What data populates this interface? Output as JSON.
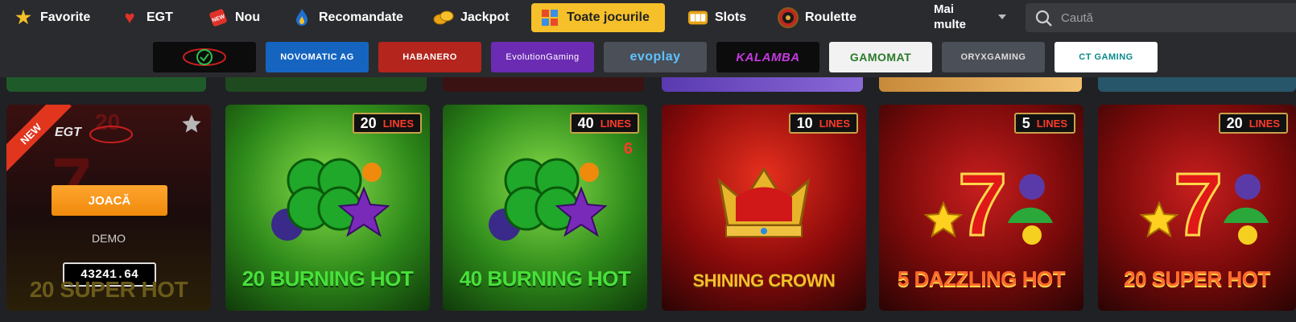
{
  "nav": {
    "items": [
      {
        "label": "Favorite",
        "icon": "star-icon"
      },
      {
        "label": "EGT",
        "icon": "heart-icon"
      },
      {
        "label": "Nou",
        "icon": "new-icon"
      },
      {
        "label": "Recomandate",
        "icon": "flame-icon"
      },
      {
        "label": "Jackpot",
        "icon": "coins-icon"
      },
      {
        "label": "Toate jocurile",
        "icon": "grid-icon"
      },
      {
        "label": "Slots",
        "icon": "slot-machine-icon"
      },
      {
        "label": "Roulette",
        "icon": "roulette-icon"
      }
    ],
    "more_label_1": "Mai",
    "more_label_2": "multe",
    "search_placeholder": "Caută"
  },
  "providers": [
    {
      "label": "EGT"
    },
    {
      "label": "NOVOMATIC AG"
    },
    {
      "label": "HABANERO"
    },
    {
      "label": "EvolutionGaming"
    },
    {
      "label": "evoplay"
    },
    {
      "label": "KALAMBA"
    },
    {
      "label": "GAMOMAT"
    },
    {
      "label": "ORYXGAMING"
    },
    {
      "label": "CT GAMING"
    }
  ],
  "games": [
    {
      "title": "20 SUPER HOT",
      "badge_new": "NEW",
      "brand": "EGT",
      "play": "JOACĂ",
      "demo": "DEMO",
      "jackpot": "43241.64"
    },
    {
      "title": "20 BURNING HOT",
      "lines": "20",
      "lines_label": "LINES"
    },
    {
      "title": "40 BURNING HOT",
      "lines": "40",
      "lines_label": "LINES"
    },
    {
      "title": "SHINING CROWN",
      "lines": "10",
      "lines_label": "LINES"
    },
    {
      "title": "5 DAZZLING HOT",
      "lines": "5",
      "lines_label": "LINES"
    },
    {
      "title": "20 SUPER HOT",
      "lines": "20",
      "lines_label": "LINES"
    }
  ],
  "colors": {
    "accent": "#f5c02a",
    "play": "#f08a0c",
    "bg": "#202124"
  }
}
